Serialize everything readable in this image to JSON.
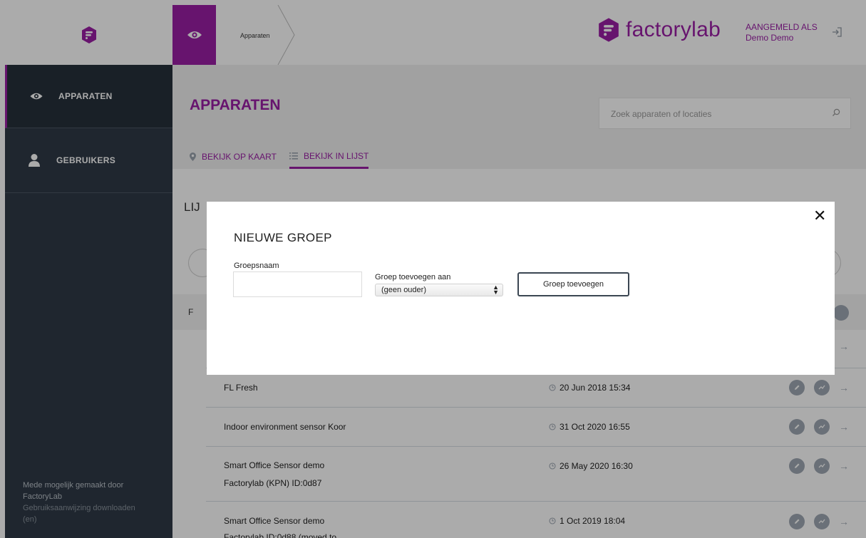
{
  "header": {
    "breadcrumb": "Apparaten",
    "brand": "factorylab",
    "user_label": "AANGEMELD ALS",
    "user_name": "Demo Demo",
    "colors": {
      "accent": "#9a1fa5",
      "sidebar": "#2f3a46"
    }
  },
  "sidebar": {
    "items": [
      {
        "label": "APPARATEN",
        "icon": "eye-icon"
      },
      {
        "label": "GEBRUIKERS",
        "icon": "user-icon"
      }
    ],
    "footer_line1": "Mede mogelijk gemaakt door",
    "footer_line2": "FactoryLab",
    "footer_link1": "Gebruiksaanwijzing downloaden",
    "footer_link2": "(en)"
  },
  "main": {
    "title": "APPARATEN",
    "search_placeholder": "Zoek apparaten of locaties",
    "tabs": [
      {
        "label": "BEKIJK OP KAART",
        "icon": "map-pin-icon"
      },
      {
        "label": "BEKIJK IN LIJST",
        "icon": "list-icon"
      }
    ],
    "list_heading": "LIJ",
    "group_label": "F",
    "rows": [
      {
        "name": "FL Fresh",
        "name2": "",
        "date": "20 Jun 2018 15:34"
      },
      {
        "name": "Indoor environment sensor Koor",
        "name2": "",
        "date": "31 Oct 2020 16:55"
      },
      {
        "name": "Smart Office Sensor demo",
        "name2": "Factorylab (KPN) ID:0d87",
        "date": "26 May 2020 16:30"
      },
      {
        "name": "Smart Office Sensor demo",
        "name2": "Factorylab ID:0d88 (moved to",
        "date": "1 Oct 2019 18:04"
      }
    ]
  },
  "modal": {
    "title": "NIEUWE GROEP",
    "name_label": "Groepsnaam",
    "name_value": "",
    "parent_label": "Groep toevoegen aan",
    "parent_selected": "(geen ouder)",
    "submit_label": "Groep toevoegen",
    "close_glyph": "✕"
  }
}
